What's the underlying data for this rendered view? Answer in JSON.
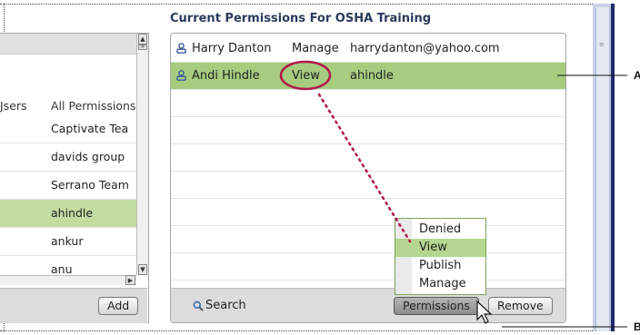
{
  "panel_title": "Current Permissions For OSHA Training",
  "left_panel": {
    "columns": [
      "Jsers",
      "All Permissions"
    ],
    "rows": [
      {
        "name": "Captivate Tea",
        "selected": false
      },
      {
        "name": "davids group",
        "selected": false
      },
      {
        "name": "Serrano Team",
        "selected": false
      },
      {
        "name": "ahindle",
        "selected": true
      },
      {
        "name": "ankur",
        "selected": false
      },
      {
        "name": "anu",
        "selected": false
      }
    ],
    "add_label": "Add"
  },
  "permissions": [
    {
      "name": "Harry  Danton",
      "permission": "Manage",
      "login": "harrydanton@yahoo.com",
      "selected": false
    },
    {
      "name": "Andi Hindle",
      "permission": "View",
      "login": "ahindle",
      "selected": true
    }
  ],
  "permissions_dropdown": {
    "options": [
      "Denied",
      "View",
      "Publish",
      "Manage"
    ],
    "selected": "View"
  },
  "footer": {
    "search_label": "Search",
    "permissions_label": "Permissions",
    "remove_label": "Remove"
  },
  "callouts": {
    "a": "A",
    "b": "B"
  },
  "colors": {
    "selection_green": "#a7cc7f",
    "callout_red": "#b0184a",
    "user_icon": "#3a5a9a",
    "title_blue": "#2b3a5a"
  },
  "icons": {
    "user": "person-icon",
    "search": "magnifier-icon",
    "cursor": "mouse-pointer-icon"
  }
}
